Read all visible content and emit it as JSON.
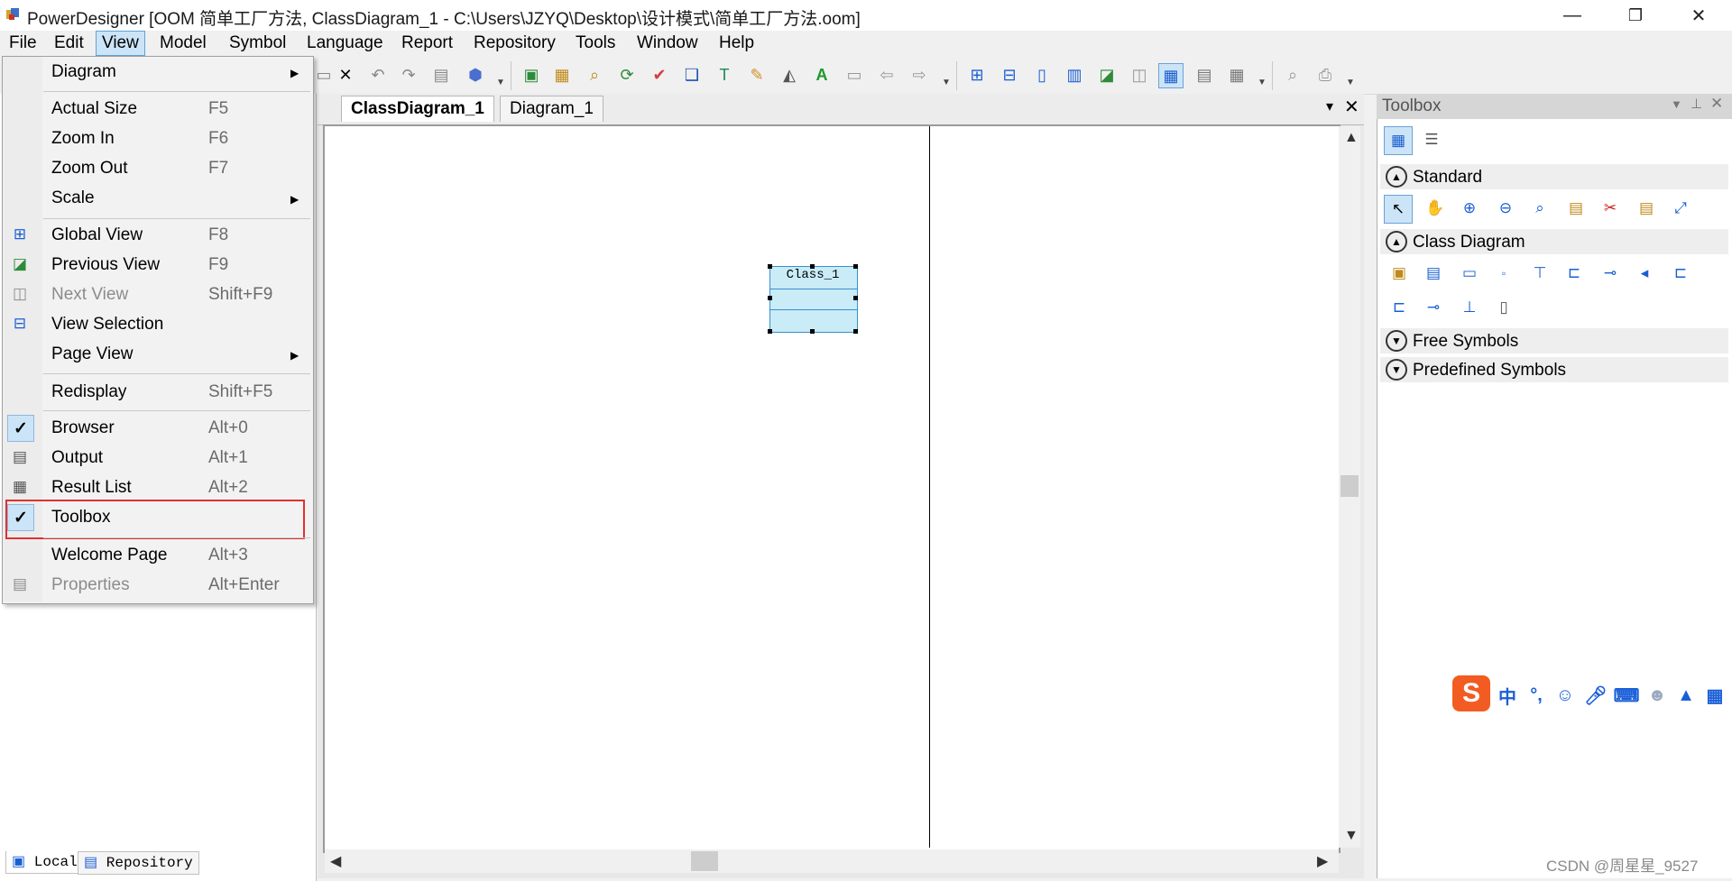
{
  "window": {
    "title": "PowerDesigner [OOM 简单工厂方法, ClassDiagram_1 - C:\\Users\\JZYQ\\Desktop\\设计模式\\简单工厂方法.oom]",
    "minimize": "—",
    "restore": "❐",
    "close": "✕"
  },
  "menubar": [
    "File",
    "Edit",
    "View",
    "Model",
    "Symbol",
    "Language",
    "Report",
    "Repository",
    "Tools",
    "Window",
    "Help"
  ],
  "view_menu": {
    "diagram": "Diagram",
    "actual_size": {
      "label": "Actual Size",
      "shortcut": "F5"
    },
    "zoom_in": {
      "label": "Zoom In",
      "shortcut": "F6"
    },
    "zoom_out": {
      "label": "Zoom Out",
      "shortcut": "F7"
    },
    "scale": "Scale",
    "global_view": {
      "label": "Global View",
      "shortcut": "F8"
    },
    "previous_view": {
      "label": "Previous View",
      "shortcut": "F9"
    },
    "next_view": {
      "label": "Next View",
      "shortcut": "Shift+F9"
    },
    "view_selection": "View Selection",
    "page_view": "Page View",
    "redisplay": {
      "label": "Redisplay",
      "shortcut": "Shift+F5"
    },
    "browser": {
      "label": "Browser",
      "shortcut": "Alt+0",
      "checked": true
    },
    "output": {
      "label": "Output",
      "shortcut": "Alt+1"
    },
    "result_list": {
      "label": "Result List",
      "shortcut": "Alt+2"
    },
    "toolbox": {
      "label": "Toolbox",
      "checked": true
    },
    "welcome_page": {
      "label": "Welcome Page",
      "shortcut": "Alt+3"
    },
    "properties": {
      "label": "Properties",
      "shortcut": "Alt+Enter"
    }
  },
  "doc_tabs": [
    "ClassDiagram_1",
    "Diagram_1"
  ],
  "diagram": {
    "class_name": "Class_1"
  },
  "left_tabs": [
    "Local",
    "Repository"
  ],
  "toolbox": {
    "title": "Toolbox",
    "sections": [
      "Standard",
      "Class Diagram",
      "Free Symbols",
      "Predefined Symbols"
    ]
  },
  "ime": {
    "chinese": "中",
    "punct": "°,"
  },
  "watermark": "CSDN @周星星_9527",
  "colors": {
    "menu_highlight": "#cce4f7",
    "red_box": "#e03030",
    "class_fill": "#c9ecf7",
    "ime_brand": "#f25c22"
  }
}
